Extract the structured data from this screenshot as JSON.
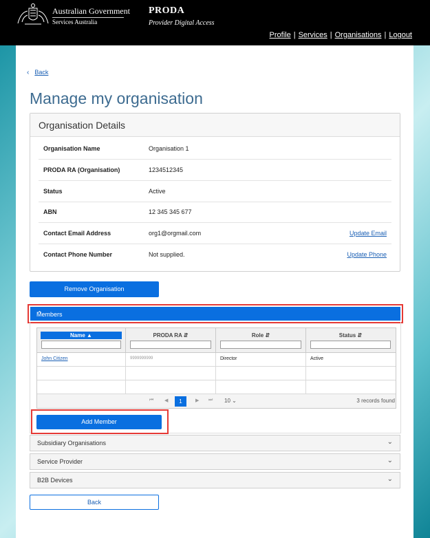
{
  "header": {
    "gov_title": "Australian Government",
    "gov_sub": "Services Australia",
    "app_name": "PRODA",
    "app_desc": "Provider Digital Access",
    "nav": [
      "Profile",
      "Services",
      "Organisations",
      "Logout"
    ]
  },
  "back_link": "Back",
  "page_title": "Manage my organisation",
  "org_details": {
    "heading": "Organisation Details",
    "rows": [
      {
        "label": "Organisation Name",
        "value": "Organisation 1",
        "action": ""
      },
      {
        "label": "PRODA RA (Organisation)",
        "value": "1234512345",
        "action": ""
      },
      {
        "label": "Status",
        "value": "Active",
        "action": ""
      },
      {
        "label": "ABN",
        "value": "12 345 345 677",
        "action": ""
      },
      {
        "label": "Contact Email Address",
        "value": "org1@orgmail.com",
        "action": "Update Email"
      },
      {
        "label": "Contact Phone Number",
        "value": "Not supplied.",
        "action": "Update Phone"
      }
    ]
  },
  "remove_button": "Remove Organisation",
  "members": {
    "heading": "Members",
    "columns": [
      "Name",
      "PRODA RA",
      "Role",
      "Status"
    ],
    "rows": [
      {
        "name": "John Citizen",
        "ra": "9999999999",
        "role": "Director",
        "status": "Active"
      }
    ],
    "pager": {
      "current_page": "1",
      "page_size": "10",
      "records": "3 records found"
    },
    "add_button": "Add Member"
  },
  "accordions": [
    "Subsidiary Organisations",
    "Service Provider",
    "B2B Devices"
  ],
  "back_button": "Back",
  "colors": {
    "primary": "#0a6fe0",
    "highlight": "#e53935",
    "title": "#3d6b90",
    "link": "#1a5fb4"
  }
}
